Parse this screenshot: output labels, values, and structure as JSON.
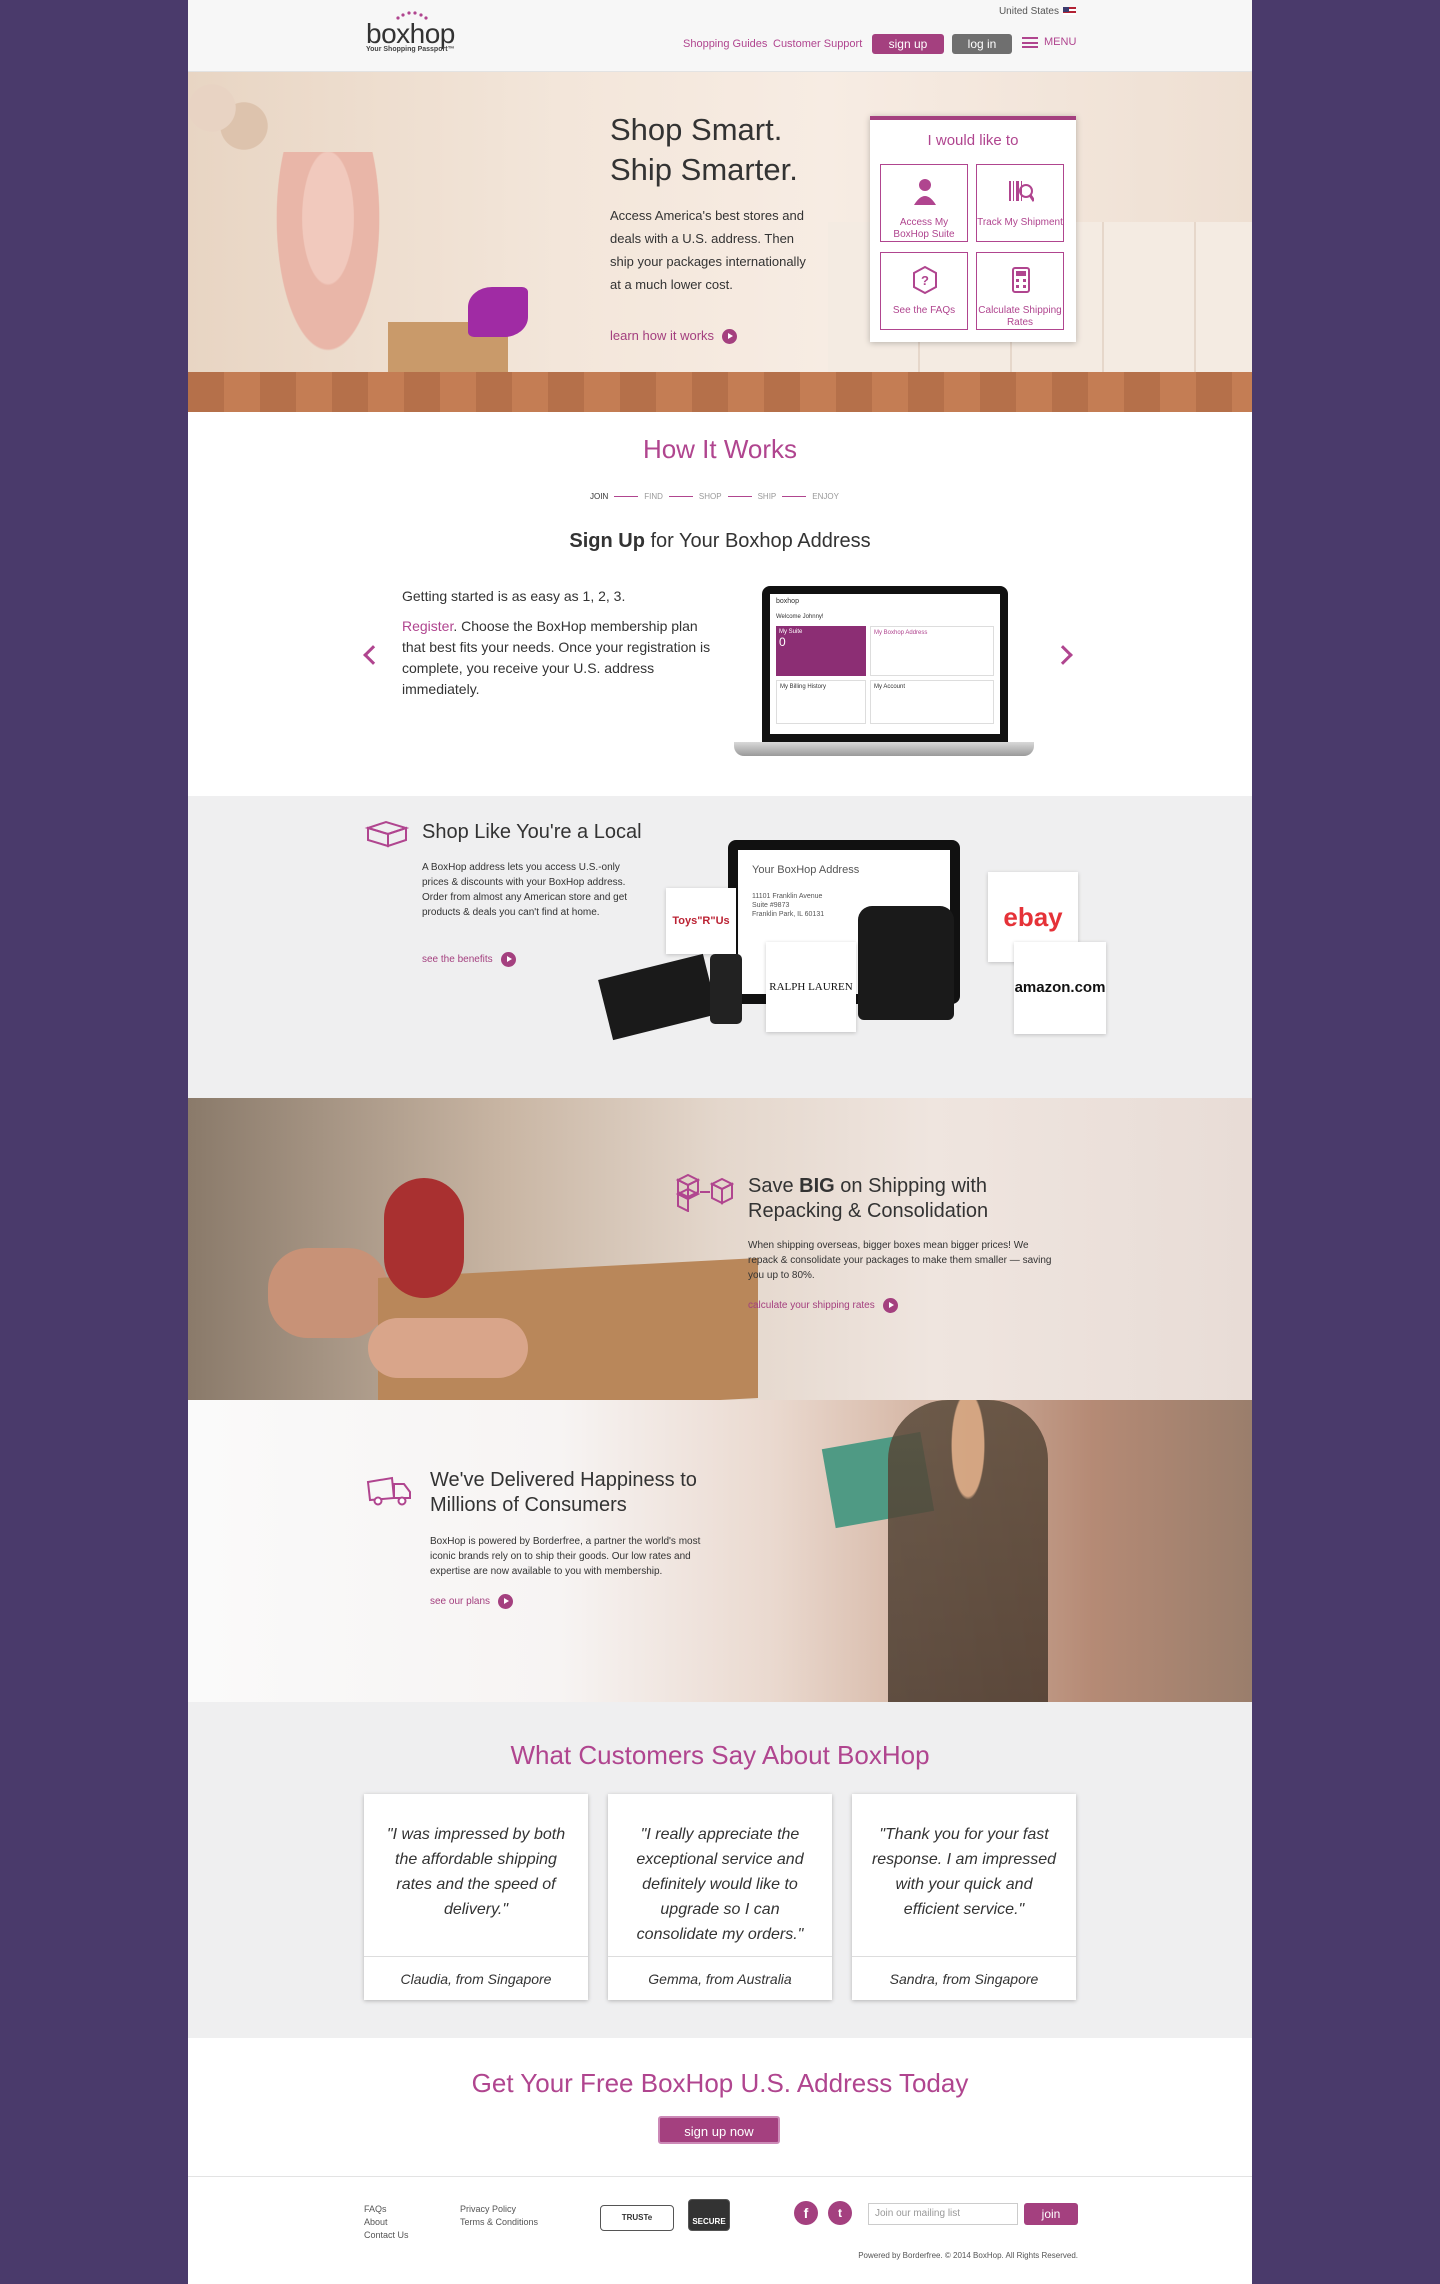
{
  "header": {
    "logo_text": "boxhop",
    "logo_tagline": "Your Shopping Passport™",
    "country": "United States",
    "nav": [
      "Shopping Guides",
      "Customer Support"
    ],
    "signup_label": "sign up",
    "login_label": "log in",
    "menu_label": "MENU"
  },
  "hero": {
    "title_line1": "Shop Smart.",
    "title_line2": "Ship Smarter.",
    "body": "Access America's best stores and deals with a U.S. address. Then ship your packages internationally at a much lower cost.",
    "link": "learn how it works",
    "panel_title": "I would like to",
    "tiles": [
      {
        "label": "Access My BoxHop Suite",
        "icon": "user-icon"
      },
      {
        "label": "Track My Shipment",
        "icon": "barcode-search-icon"
      },
      {
        "label": "See the FAQs",
        "icon": "question-hex-icon"
      },
      {
        "label": "Calculate Shipping Rates",
        "icon": "calculator-icon"
      }
    ]
  },
  "how": {
    "title": "How It Works",
    "steps": [
      "JOIN",
      "FIND",
      "SHOP",
      "SHIP",
      "ENJOY"
    ],
    "subtitle_bold": "Sign Up",
    "subtitle_rest": " for Your Boxhop Address",
    "intro": "Getting started is as easy as 1, 2, 3.",
    "register": "Register",
    "body": ". Choose the BoxHop membership plan that best fits your needs. Once your registration is complete, you receive your U.S. address immediately.",
    "screen": {
      "greeting": "Welcome Johnny!",
      "my_suite": "My Suite",
      "my_address": "My Boxhop Address",
      "billing": "My Billing History",
      "account": "My Account",
      "suite_count": "0"
    }
  },
  "shop": {
    "title": "Shop Like You're a Local",
    "body": "A BoxHop address lets you access U.S.-only prices & discounts with your BoxHop address. Order from almost any American store and get products & deals you can't find at home.",
    "link": "see the benefits",
    "address_title": "Your BoxHop Address",
    "address_lines": [
      "11101 Franklin Avenue",
      "Suite #9873",
      "Franklin Park, IL 60131"
    ],
    "brands": [
      "Toys\"R\"Us",
      "RALPH LAUREN",
      "ebay",
      "amazon.com"
    ]
  },
  "save": {
    "title_pre": "Save ",
    "title_bold": "BIG",
    "title_post": " on Shipping with",
    "title_line2": "Repacking & Consolidation",
    "body": "When shipping overseas, bigger boxes mean bigger prices! We repack & consolidate your packages to make them smaller — saving you up to 80%.",
    "link": "calculate your shipping rates"
  },
  "delivered": {
    "title_line1": "We've Delivered Happiness to",
    "title_line2": "Millions of Consumers",
    "body": "BoxHop is powered by Borderfree, a partner the world's most iconic brands rely on to ship their goods. Our low rates and expertise are now available to you with membership.",
    "link": "see our plans"
  },
  "testimonials": {
    "title": "What Customers Say About BoxHop",
    "items": [
      {
        "quote": "\"I was impressed by both the affordable shipping rates and the speed of delivery.\"",
        "name": "Claudia, from Singapore"
      },
      {
        "quote": "\"I really appreciate the exceptional service and definitely would like to upgrade so I can consolidate my orders.\"",
        "name": "Gemma, from Australia"
      },
      {
        "quote": "\"Thank you for your fast response. I am impressed with your quick and efficient service.\"",
        "name": "Sandra, from Singapore"
      }
    ]
  },
  "cta": {
    "title": "Get Your Free BoxHop U.S. Address Today",
    "button": "sign up now"
  },
  "footer": {
    "col1": [
      "FAQs",
      "About",
      "Contact Us"
    ],
    "col2": [
      "Privacy Policy",
      "Terms & Conditions"
    ],
    "badge1": "TRUSTe",
    "badge2": "SECURE",
    "mail_placeholder": "Join our mailing list",
    "join": "join",
    "copyright": "Powered by Borderfree. © 2014 BoxHop. All Rights Reserved."
  },
  "colors": {
    "brand": "#a4407f",
    "background": "#4a3a6b"
  }
}
